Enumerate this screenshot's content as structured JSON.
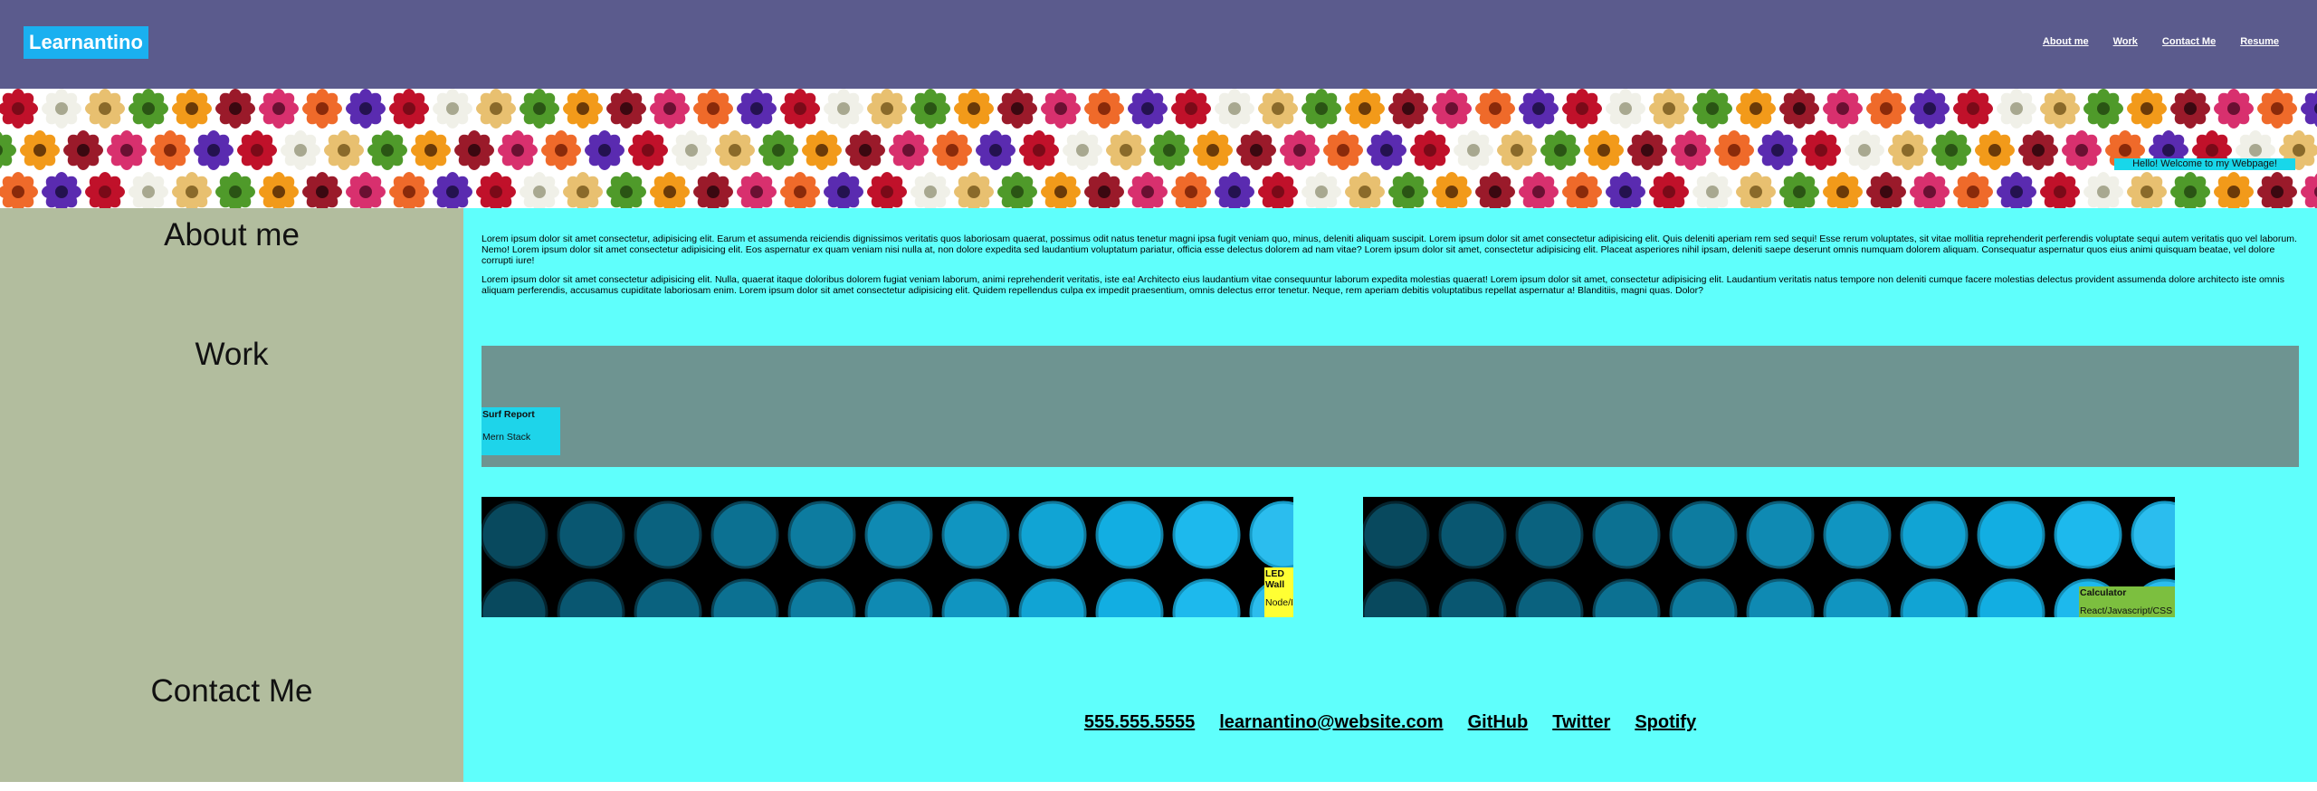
{
  "header": {
    "logo": "Learnantino",
    "nav": [
      "About me",
      "Work",
      "Contact Me",
      "Resume"
    ]
  },
  "hero": {
    "welcome": "Hello! Welcome to my Webpage!"
  },
  "sidebar": {
    "about": "About me",
    "work": "Work",
    "contact": "Contact Me"
  },
  "about": {
    "p1": "Lorem ipsum dolor sit amet consectetur, adipisicing elit. Earum et assumenda reiciendis dignissimos veritatis quos laboriosam quaerat, possimus odit natus tenetur magni ipsa fugit veniam quo, minus, deleniti aliquam suscipit. Lorem ipsum dolor sit amet consectetur adipisicing elit. Quis deleniti aperiam rem sed sequi! Esse rerum voluptates, sit vitae mollitia reprehenderit perferendis voluptate sequi autem veritatis quo vel laborum. Nemo! Lorem ipsum dolor sit amet consectetur adipisicing elit. Eos aspernatur ex quam veniam nisi nulla at, non dolore expedita sed laudantium voluptatum pariatur, officia esse delectus dolorem ad nam vitae? Lorem ipsum dolor sit amet, consectetur adipisicing elit. Placeat asperiores nihil ipsam, deleniti saepe deserunt omnis numquam dolorem aliquam. Consequatur aspernatur quos eius animi quisquam beatae, vel dolore corrupti iure!",
    "p2": "Lorem ipsum dolor sit amet consectetur adipisicing elit. Nulla, quaerat itaque doloribus dolorem fugiat veniam laborum, animi reprehenderit veritatis, iste ea! Architecto eius laudantium vitae consequuntur laborum expedita molestias quaerat! Lorem ipsum dolor sit amet, consectetur adipisicing elit. Laudantium veritatis natus tempore non deleniti cumque facere molestias delectus provident assumenda dolore architecto iste omnis aliquam perferendis, accusamus cupiditate laboriosam enim. Lorem ipsum dolor sit amet consectetur adipisicing elit. Quidem repellendus culpa ex impedit praesentium, omnis delectus error tenetur. Neque, rem aperiam debitis voluptatibus repellat aspernatur a! Blanditiis, magni quas. Dolor?"
  },
  "work": {
    "surf": {
      "title": "Surf Report",
      "stack": "Mern Stack",
      "color": "#1ed4ea"
    },
    "led": {
      "title": "LED Wall",
      "stack": "Node/IoT",
      "color": "#ffff33"
    },
    "calc": {
      "title": "Calculator",
      "stack": "React/Javascript/CSS",
      "color": "#7cbf3f"
    }
  },
  "contact": [
    "555.555.5555",
    "learnantino@website.com",
    "GitHub",
    "Twitter",
    "Spotify"
  ],
  "colors": {
    "header_bg": "#5b5b8d",
    "logo_bg": "#1ab0f0",
    "sidebar_bg": "#b2bd9e",
    "main_bg": "#5ffffc",
    "work_banner_bg": "#6e9491"
  }
}
